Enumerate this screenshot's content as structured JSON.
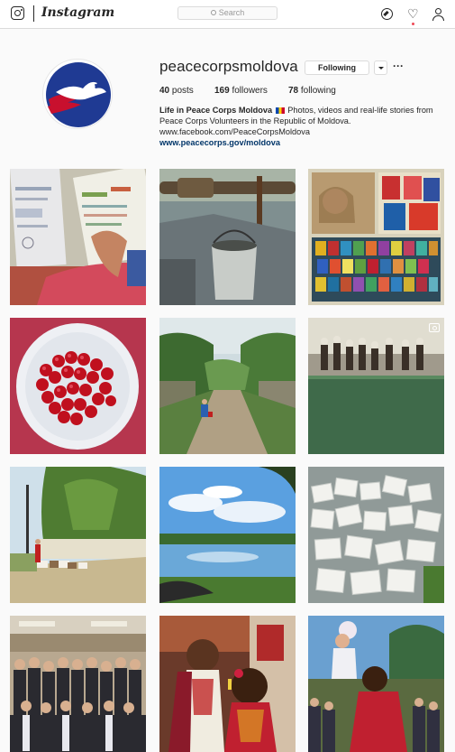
{
  "topbar": {
    "wordmark": "Instagram",
    "search_placeholder": "Search",
    "icons": [
      "instagram-glyph-icon",
      "compass-icon",
      "heart-icon",
      "person-icon",
      "search-icon"
    ]
  },
  "profile": {
    "username": "peacecorpsmoldova",
    "follow_label": "Following",
    "more_label": "···",
    "posts_count": "40",
    "posts_label": "posts",
    "followers_count": "169",
    "followers_label": "followers",
    "following_count": "78",
    "following_label": "following",
    "bio_name": "Life in Peace Corps Moldova",
    "bio_text": "Photos, videos and real-life stories from Peace Corps Volunteers in the Republic of Moldova.",
    "bio_url_text": "www.facebook.com/PeaceCorpsMoldova",
    "bio_link": "www.peacecorps.gov/moldova"
  },
  "colors": {
    "link": "#003569",
    "notification_dot": "#ed4956",
    "border": "#dbdbdb",
    "logo_navy": "#1f3a93",
    "logo_red": "#c8102e"
  },
  "posts": [
    {
      "subject": "Child reading textbook",
      "is_video": false
    },
    {
      "subject": "Well bucket",
      "is_video": false
    },
    {
      "subject": "Books collage, The Cat in the Hat",
      "is_video": false
    },
    {
      "subject": "Cherries on plate",
      "is_video": false
    },
    {
      "subject": "Child on dirt road",
      "is_video": false
    },
    {
      "subject": "Dance performance",
      "is_video": true
    },
    {
      "subject": "Village road with goats",
      "is_video": false
    },
    {
      "subject": "Lake with clouds",
      "is_video": false
    },
    {
      "subject": "White blocks",
      "is_video": false
    },
    {
      "subject": "Group photo",
      "is_video": false
    },
    {
      "subject": "Couple in traditional costume",
      "is_video": false
    },
    {
      "subject": "Child on shoulders",
      "is_video": false
    }
  ]
}
